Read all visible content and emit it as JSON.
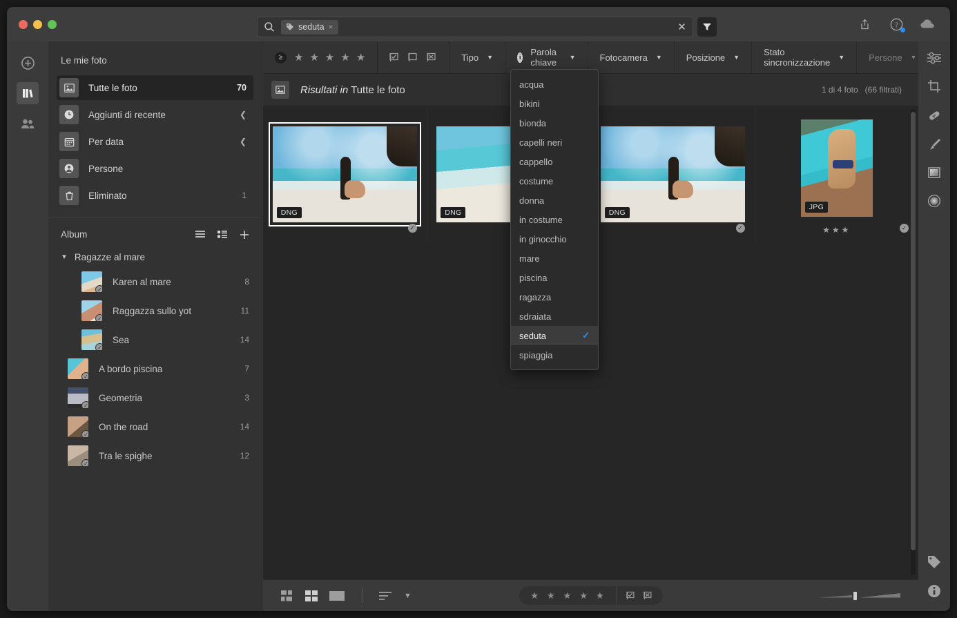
{
  "window": {
    "traffic_lights": [
      "close",
      "minimize",
      "maximize"
    ]
  },
  "search": {
    "icon": "search-icon",
    "chip_icon": "tag-icon",
    "chip_label": "seduta",
    "chip_remove": "×",
    "clear_label": "✕",
    "filter_icon": "funnel-icon"
  },
  "titlebar_actions": [
    {
      "name": "share-icon",
      "label": "Condividi"
    },
    {
      "name": "help-icon",
      "label": "Aiuto"
    },
    {
      "name": "cloud-icon",
      "label": "Cloud"
    }
  ],
  "left_rail": [
    {
      "name": "add-photos-icon",
      "label": "Aggiungi foto",
      "active": false
    },
    {
      "name": "library-icon",
      "label": "Libreria",
      "active": true
    },
    {
      "name": "shared-icon",
      "label": "Condivisi",
      "active": false
    }
  ],
  "sidebar": {
    "title": "Le mie foto",
    "items": [
      {
        "icon": "all-photos-icon",
        "label": "Tutte le foto",
        "count": "70",
        "active": true,
        "chevron": false
      },
      {
        "icon": "clock-icon",
        "label": "Aggiunti di recente",
        "count": "",
        "active": false,
        "chevron": true
      },
      {
        "icon": "calendar-icon",
        "label": "Per data",
        "count": "",
        "active": false,
        "chevron": true
      },
      {
        "icon": "person-icon",
        "label": "Persone",
        "count": "",
        "active": false,
        "chevron": false
      },
      {
        "icon": "trash-icon",
        "label": "Eliminato",
        "count": "1",
        "active": false,
        "chevron": false
      }
    ],
    "album_section": {
      "title": "Album",
      "view_list_icon": "list-view-icon",
      "view_grid_icon": "grid-view-icon",
      "add_icon": "plus-icon",
      "group": {
        "label": "Ragazze al mare",
        "expanded": true
      },
      "nested": [
        {
          "label": "Karen al mare",
          "count": "8",
          "c1": "#7ec8e8",
          "c2": "#d9b892"
        },
        {
          "label": "Raggazza sullo yot",
          "count": "11",
          "c1": "#9fd3e8",
          "c2": "#c98f72"
        },
        {
          "label": "Sea",
          "count": "14",
          "c1": "#6fc0dd",
          "c2": "#d8c08e"
        }
      ],
      "top": [
        {
          "label": "A bordo piscina",
          "count": "7",
          "c1": "#58c4d8",
          "c2": "#e0b38c"
        },
        {
          "label": "Geometria",
          "count": "3",
          "c1": "#43506b",
          "c2": "#b9bcc4"
        },
        {
          "label": "On the road",
          "count": "14",
          "c1": "#c7a183",
          "c2": "#6b5642"
        },
        {
          "label": "Tra le spighe",
          "count": "12",
          "c1": "#c9b6a4",
          "c2": "#9b8e7e"
        }
      ]
    }
  },
  "filterbar": {
    "rating_operator": "≥",
    "star_count": 5,
    "flags": [
      "flag-picked-icon",
      "flag-unflagged-icon",
      "flag-rejected-icon"
    ],
    "segments": [
      {
        "label": "Tipo",
        "chevron": "⌄",
        "dim": false,
        "info": false
      },
      {
        "label": "Parola chiave",
        "chevron": "⌄",
        "dim": false,
        "info": true
      },
      {
        "label": "Fotocamera",
        "chevron": "⌄",
        "dim": false,
        "info": false
      },
      {
        "label": "Posizione",
        "chevron": "⌄",
        "dim": false,
        "info": false
      },
      {
        "label": "Stato sincronizzazione",
        "chevron": "⌄",
        "dim": false,
        "info": false
      },
      {
        "label": "Persone",
        "chevron": "⌄",
        "dim": true,
        "info": false
      }
    ]
  },
  "keyword_dropdown": {
    "options": [
      {
        "label": "acqua",
        "selected": false
      },
      {
        "label": "bikini",
        "selected": false
      },
      {
        "label": "bionda",
        "selected": false
      },
      {
        "label": "capelli neri",
        "selected": false
      },
      {
        "label": "cappello",
        "selected": false
      },
      {
        "label": "costume",
        "selected": false
      },
      {
        "label": "donna",
        "selected": false
      },
      {
        "label": "in costume",
        "selected": false
      },
      {
        "label": "in ginocchio",
        "selected": false
      },
      {
        "label": "mare",
        "selected": false
      },
      {
        "label": "piscina",
        "selected": false
      },
      {
        "label": "ragazza",
        "selected": false
      },
      {
        "label": "sdraiata",
        "selected": false
      },
      {
        "label": "seduta",
        "selected": true
      },
      {
        "label": "spiaggia",
        "selected": false
      }
    ],
    "check_glyph": "✓",
    "accent": "#2f93f0"
  },
  "results": {
    "icon": "photo-icon",
    "prefix": "Risultati in",
    "scope": "Tutte le foto",
    "count_text": "1 di 4 foto",
    "filtered_text": "(66 filtrati)"
  },
  "photos": [
    {
      "format": "DNG",
      "selected": true,
      "checked": true,
      "stars": 0,
      "orientation": "landscape",
      "sky": "#74b8dc",
      "sea": "#45b7c9",
      "sand": "#e8e3da"
    },
    {
      "format": "DNG",
      "selected": false,
      "checked": false,
      "stars": 0,
      "orientation": "landscape",
      "sky": "#6fc5dd",
      "sea": "#57c8d6",
      "sand": "#ece8de"
    },
    {
      "format": "DNG",
      "selected": false,
      "checked": true,
      "stars": 0,
      "orientation": "landscape",
      "sky": "#74b8dc",
      "sea": "#45b7c9",
      "sand": "#e8e3da"
    },
    {
      "format": "JPG",
      "selected": false,
      "checked": true,
      "stars": 3,
      "orientation": "portrait",
      "sky": "#3fc8d6",
      "sea": "#35bccb",
      "sand": "#9b7151"
    }
  ],
  "star_glyph": "★",
  "bottombar": {
    "view_buttons": [
      {
        "name": "square-grid-view-icon",
        "active": false
      },
      {
        "name": "grid-view-icon",
        "active": false
      },
      {
        "name": "single-photo-view-icon",
        "active": false
      }
    ],
    "sort_icon": "sort-icon",
    "sort_chevron": "⌄",
    "rating_stars": 5,
    "flag_picked": "flag-picked-icon",
    "flag_rejected": "flag-rejected-icon",
    "zoom_slider_label": "Dimensione miniature"
  },
  "right_rail": [
    {
      "name": "edit-sliders-icon",
      "label": "Modifica"
    },
    {
      "name": "crop-icon",
      "label": "Ritaglia"
    },
    {
      "name": "healing-icon",
      "label": "Correzione"
    },
    {
      "name": "brush-icon",
      "label": "Pennello"
    },
    {
      "name": "gradient-icon",
      "label": "Filtro lineare"
    },
    {
      "name": "radial-icon",
      "label": "Filtro radiale"
    },
    {
      "name": "tag-icon",
      "label": "Parole chiave"
    },
    {
      "name": "info-icon",
      "label": "Informazioni"
    }
  ]
}
